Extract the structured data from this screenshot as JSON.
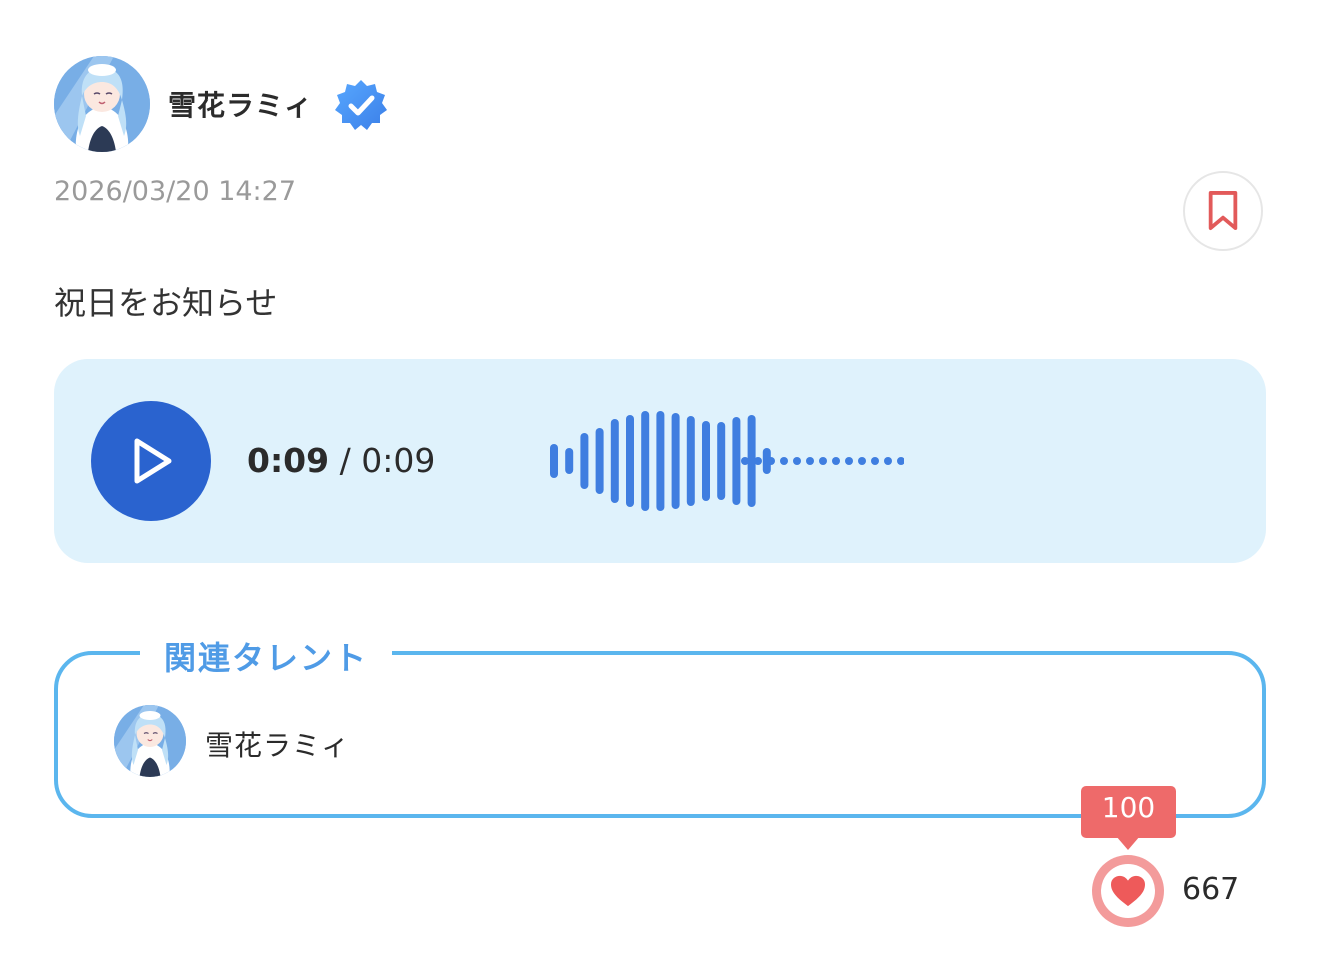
{
  "post": {
    "author_name": "雪花ラミィ",
    "date": "2026/03/20 14:27",
    "text": "祝日をお知らせ"
  },
  "audio": {
    "current_time": "0:09",
    "separator": "/",
    "duration": "0:09",
    "progress": 1.0,
    "accent_color": "#2a63cf",
    "wave_color": "#3f7ee0"
  },
  "related": {
    "title": "関連タレント",
    "talents": [
      {
        "name": "雪花ラミィ"
      }
    ]
  },
  "reactions": {
    "badge_count": "100",
    "like_count": "667",
    "heart_color": "#ee5a5a"
  },
  "icons": {
    "verified": "verified-badge-icon",
    "bookmark": "bookmark-icon",
    "play": "play-icon",
    "heart": "heart-icon"
  }
}
